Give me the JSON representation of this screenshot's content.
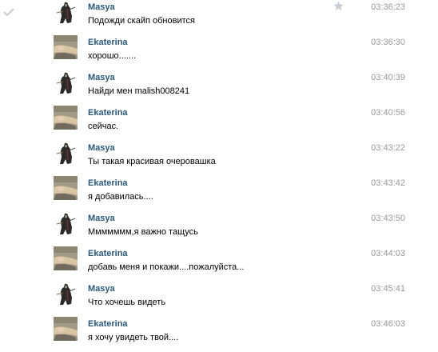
{
  "messages": [
    {
      "author": "Masya",
      "text": "Подожди скайп обновится",
      "time": "03:36:23",
      "avatar": "masya-avatar"
    },
    {
      "author": "Ekaterina",
      "text": "хорошо.......",
      "time": "03:36:30",
      "avatar": "ekaterina-avatar"
    },
    {
      "author": "Masya",
      "text": "Найди мен malish008241",
      "time": "03:40:39",
      "avatar": "masya-avatar"
    },
    {
      "author": "Ekaterina",
      "text": "сейчас.",
      "time": "03:40:56",
      "avatar": "ekaterina-avatar"
    },
    {
      "author": "Masya",
      "text": "Ты такая красивая очеровашка",
      "time": "03:43:22",
      "avatar": "masya-avatar"
    },
    {
      "author": "Ekaterina",
      "text": "я добавилась....",
      "time": "03:43:42",
      "avatar": "ekaterina-avatar"
    },
    {
      "author": "Masya",
      "text": "Ммммммм,я важно тащусь",
      "time": "03:43:50",
      "avatar": "masya-avatar"
    },
    {
      "author": "Ekaterina",
      "text": "добавь меня и покажи....пожалуйста...",
      "time": "03:44:03",
      "avatar": "ekaterina-avatar"
    },
    {
      "author": "Masya",
      "text": "Что хочешь видеть",
      "time": "03:45:41",
      "avatar": "masya-avatar"
    },
    {
      "author": "Ekaterina",
      "text": "я хочу увидеть твой....",
      "time": "03:46:03",
      "avatar": "ekaterina-avatar"
    }
  ],
  "icons": {
    "check": "check-icon",
    "star": "star-icon"
  },
  "colors": {
    "author": "#2b587a",
    "time": "#999999",
    "text": "#000000",
    "icon_gray": "#c4ccd4"
  }
}
